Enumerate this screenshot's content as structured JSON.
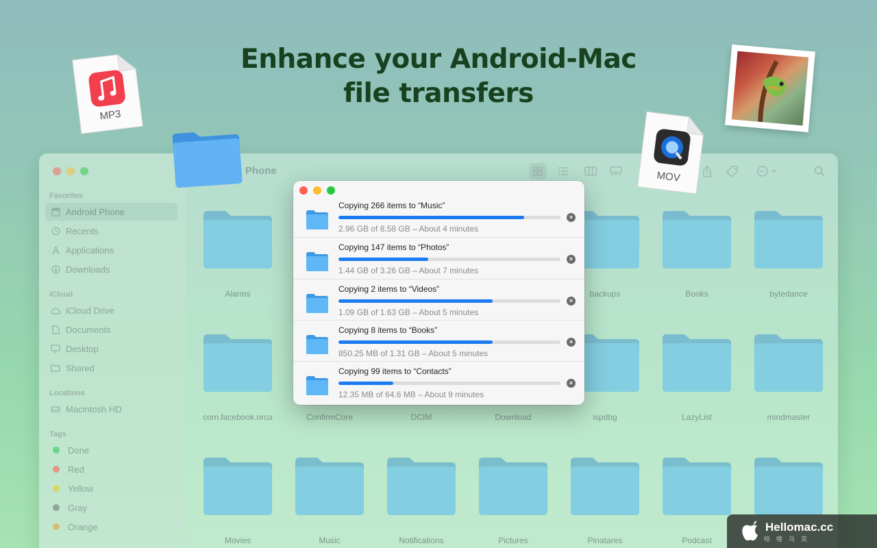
{
  "headline": {
    "line1": "Enhance your Android-Mac",
    "line2": "file transfers"
  },
  "finder": {
    "title": "Phone",
    "sidebar": {
      "favorites_label": "Favorites",
      "favorites": [
        {
          "label": "Android Phone",
          "icon": "phone-icon",
          "active": true
        },
        {
          "label": "Recents",
          "icon": "clock-icon"
        },
        {
          "label": "Applications",
          "icon": "applications-icon"
        },
        {
          "label": "Downloads",
          "icon": "download-icon"
        }
      ],
      "icloud_label": "iCloud",
      "icloud": [
        {
          "label": "iCloud Drive",
          "icon": "cloud-icon"
        },
        {
          "label": "Documents",
          "icon": "document-icon"
        },
        {
          "label": "Desktop",
          "icon": "desktop-icon"
        },
        {
          "label": "Shared",
          "icon": "shared-folder-icon"
        }
      ],
      "locations_label": "Locations",
      "locations": [
        {
          "label": "Macintosh HD",
          "icon": "disk-icon"
        }
      ],
      "tags_label": "Tags",
      "tags": [
        {
          "label": "Done",
          "color": "#34c759"
        },
        {
          "label": "Red",
          "color": "#ff5f57"
        },
        {
          "label": "Yellow",
          "color": "#e6d11e"
        },
        {
          "label": "Gray",
          "color": "#6e7b76"
        },
        {
          "label": "Orange",
          "color": "#e7a23a"
        }
      ]
    },
    "folders_row1": [
      "Alarms",
      "",
      "",
      "",
      "backups",
      "Books",
      "bytedance"
    ],
    "folders_row2": [
      "com.facebook.orca",
      "ConfirmCore",
      "DCIM",
      "Download",
      "ispdbg",
      "LazyList",
      "mindmaster"
    ],
    "folders_row3": [
      "Movies",
      "Music",
      "Notifications",
      "Pictures",
      "Pinatares",
      "Podcast",
      ""
    ]
  },
  "dialog": {
    "transfers": [
      {
        "title": "Copying 266 items to “Music”",
        "status": "2.96 GB of 8.58 GB – About 4 minutes",
        "progress": 0.836
      },
      {
        "title": "Copying 147 items to “Photos”",
        "status": "1.44 GB of 3.26 GB – About 7 minutes",
        "progress": 0.404
      },
      {
        "title": "Copying 2 items to “Videos”",
        "status": "1.09 GB of 1.63 GB – About 5 minutes",
        "progress": 0.694
      },
      {
        "title": "Copying 8 items to “Books”",
        "status": "850.25 MB of 1.31 GB – About 5 minutes",
        "progress": 0.694
      },
      {
        "title": "Copying 99 items to “Contacts”",
        "status": "12.35 MB of 64.6 MB – About 9 minutes",
        "progress": 0.247
      }
    ]
  },
  "decorations": {
    "mp3_label": "MP3",
    "mov_label": "MOV"
  },
  "watermark": {
    "text": "Hellomac.cc",
    "sub": "哈喽马克"
  },
  "colors": {
    "accent": "#1b7bf0",
    "folder": "#7fcde0",
    "headline": "#17411f"
  }
}
